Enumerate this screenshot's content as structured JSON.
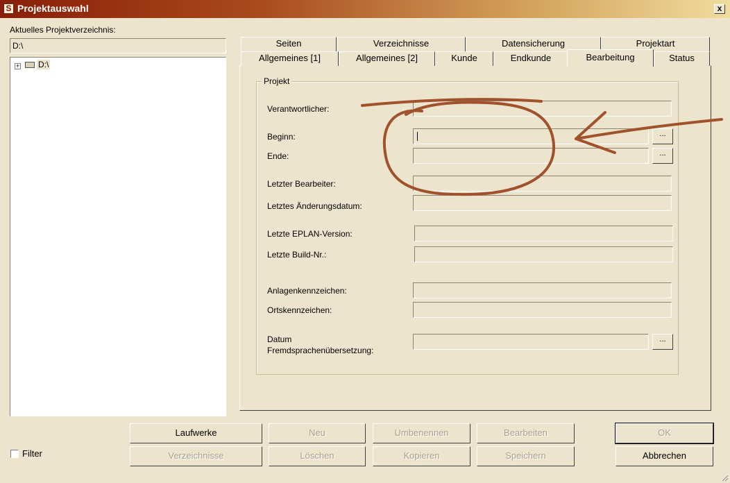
{
  "window": {
    "title": "Projektauswahl",
    "close_label": "x"
  },
  "left": {
    "dir_label": "Aktuelles Projektverzeichnis:",
    "dir_value": "D:\\",
    "tree_items": [
      {
        "label": "D:\\",
        "expander": "+"
      }
    ],
    "filter_label": "Filter"
  },
  "tabs": {
    "row1": [
      "Seiten",
      "Verzeichnisse",
      "Datensicherung",
      "Projektart"
    ],
    "row2": [
      "Allgemeines [1]",
      "Allgemeines [2]",
      "Kunde",
      "Endkunde",
      "Bearbeitung",
      "Status"
    ],
    "active": "Bearbeitung"
  },
  "group": {
    "title": "Projekt",
    "fields": {
      "verantwortlicher": {
        "label": "Verantwortlicher:",
        "value": ""
      },
      "beginn": {
        "label": "Beginn:",
        "value": ""
      },
      "ende": {
        "label": "Ende:",
        "value": ""
      },
      "letzter_bearbeiter": {
        "label": "Letzter Bearbeiter:",
        "value": ""
      },
      "aenderungsdatum": {
        "label": "Letztes Änderungsdatum:",
        "value": ""
      },
      "eplan_version": {
        "label": "Letzte EPLAN-Version:",
        "value": ""
      },
      "build_nr": {
        "label": "Letzte Build-Nr.:",
        "value": ""
      },
      "anlagenkennzeichen": {
        "label": "Anlagenkennzeichen:",
        "value": ""
      },
      "ortskennzeichen": {
        "label": "Ortskennzeichen:",
        "value": ""
      },
      "datum_label_line1": "Datum",
      "datum_label_line2": "Fremdsprachenübersetzung:"
    },
    "browse_label": "..."
  },
  "buttons": {
    "laufwerke": "Laufwerke",
    "neu": "Neu",
    "umbenennen": "Umbenennen",
    "bearbeiten": "Bearbeiten",
    "ok": "OK",
    "verzeichnisse": "Verzeichnisse",
    "loeschen": "Löschen",
    "kopieren": "Kopieren",
    "speichern": "Speichern",
    "abbrechen": "Abbrechen"
  },
  "colors": {
    "annotation": "#a0522d",
    "dialog_bg": "#ece4cd",
    "title_start": "#8a1e08"
  }
}
